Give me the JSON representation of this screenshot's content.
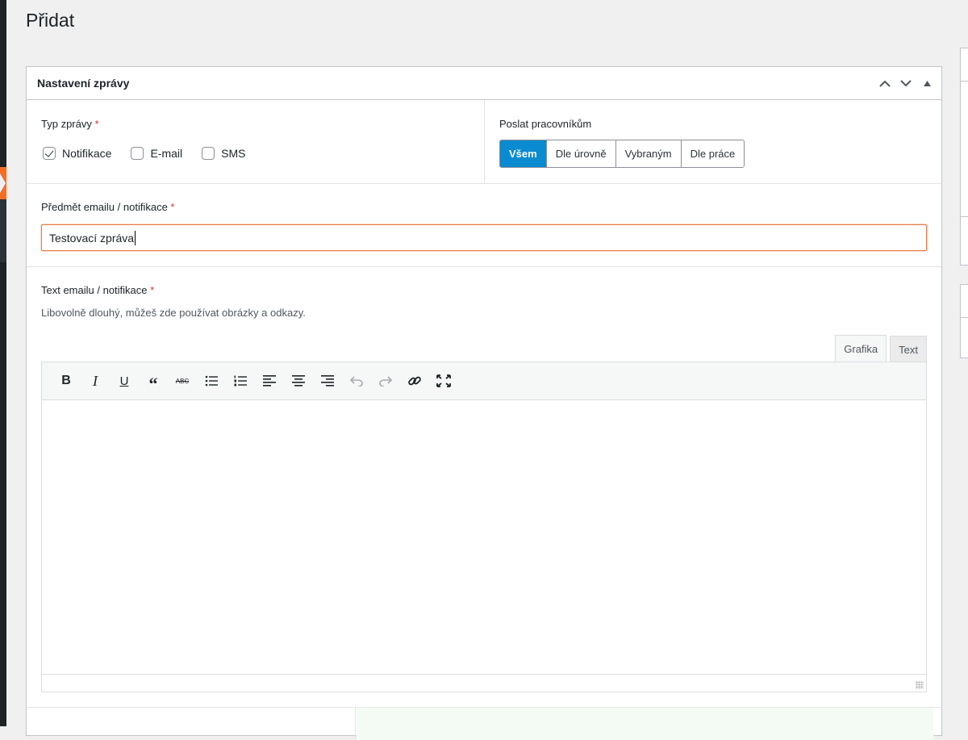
{
  "page": {
    "title": "Přidat"
  },
  "postbox": {
    "title": "Nastavení zprávy",
    "actions": {
      "up_icon": "chevron-up-icon",
      "down_icon": "chevron-down-icon",
      "toggle_icon": "triangle-up-icon"
    }
  },
  "message_type": {
    "label": "Typ zprávy",
    "required_mark": "*",
    "options": [
      {
        "label": "Notifikace",
        "checked": true
      },
      {
        "label": "E-mail",
        "checked": false
      },
      {
        "label": "SMS",
        "checked": false
      }
    ]
  },
  "send_to": {
    "label": "Poslat pracovníkům",
    "options": [
      {
        "label": "Všem",
        "active": true
      },
      {
        "label": "Dle úrovně",
        "active": false
      },
      {
        "label": "Vybraným",
        "active": false
      },
      {
        "label": "Dle práce",
        "active": false
      }
    ]
  },
  "subject": {
    "label": "Předmět emailu / notifikace",
    "required_mark": "*",
    "value": "Testovací zpráva"
  },
  "body": {
    "label": "Text emailu / notifikace",
    "required_mark": "*",
    "description": "Libovolně dlouhý, můžeš zde používat obrázky a odkazy.",
    "tabs": [
      {
        "label": "Grafika",
        "active": true
      },
      {
        "label": "Text",
        "active": false
      }
    ],
    "toolbar": [
      "bold-icon",
      "italic-icon",
      "underline-icon",
      "blockquote-icon",
      "strikethrough-icon",
      "bullet-list-icon",
      "numbered-list-icon",
      "align-left-icon",
      "align-center-icon",
      "align-right-icon",
      "undo-icon",
      "redo-icon",
      "link-icon",
      "fullscreen-icon"
    ],
    "content": ""
  },
  "colors": {
    "accent": "#0a8ad1",
    "required": "#d63638",
    "input_focus": "#e87b4d",
    "sidebar_highlight": "#f56e28"
  }
}
